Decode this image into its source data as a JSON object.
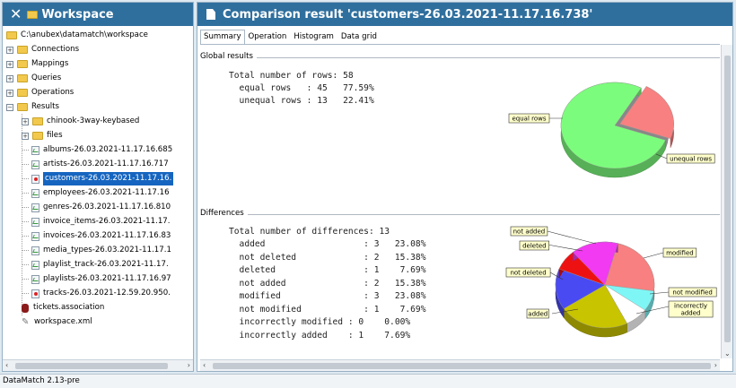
{
  "workspace": {
    "title": "Workspace",
    "close_glyph": "✕",
    "root_path": "C:\\anubex\\datamatch\\workspace",
    "top_nodes": [
      "Connections",
      "Mappings",
      "Queries",
      "Operations",
      "Results"
    ],
    "result_folders": [
      "chinook-3way-keybased",
      "files"
    ],
    "result_files": [
      "albums-26.03.2021-11.17.16.685",
      "artists-26.03.2021-11.17.16.717",
      "customers-26.03.2021-11.17.16.",
      "employees-26.03.2021-11.17.16",
      "genres-26.03.2021-11.17.16.810",
      "invoice_items-26.03.2021-11.17.",
      "invoices-26.03.2021-11.17.16.83",
      "media_types-26.03.2021-11.17.1",
      "playlist_track-26.03.2021-11.17.",
      "playlists-26.03.2021-11.17.16.97",
      "tracks-26.03.2021-12.59.20.950."
    ],
    "other_files": [
      "tickets.association",
      "workspace.xml"
    ]
  },
  "result": {
    "title": "Comparison result 'customers-26.03.2021-11.17.16.738'",
    "tabs": [
      "Summary",
      "Operation",
      "Histogram",
      "Data grid"
    ],
    "active_tab": "Summary"
  },
  "global": {
    "section_title": "Global results",
    "lines": [
      "Total number of rows: 58",
      "  equal rows   : 45   77.59%",
      "  unequal rows : 13   22.41%"
    ]
  },
  "differences": {
    "section_title": "Differences",
    "lines": [
      "Total number of differences: 13",
      "  added                   : 3   23.08%",
      "  not deleted             : 2   15.38%",
      "  deleted                 : 1    7.69%",
      "  not added               : 2   15.38%",
      "  modified                : 3   23.08%",
      "  not modified            : 1    7.69%",
      "  incorrectly modified : 0    0.00%",
      "  incorrectly added    : 1    7.69%"
    ]
  },
  "chart_data": [
    {
      "type": "pie",
      "title": "",
      "labels": [
        "equal rows",
        "unequal rows"
      ],
      "values": [
        45,
        13
      ],
      "colors": [
        "#7cfc7c",
        "#f88080"
      ]
    },
    {
      "type": "pie",
      "title": "",
      "labels": [
        "modified",
        "not modified",
        "incorrectly added",
        "added",
        "not added",
        "deleted",
        "not added"
      ],
      "display_labels": [
        "modified",
        "not modified",
        "incorrectly\nadded",
        "added",
        "not deleted",
        "deleted",
        "not added"
      ],
      "values": [
        3,
        1,
        1,
        3,
        2,
        1,
        2
      ],
      "colors": [
        "#f88080",
        "#7ff6f6",
        "#ffffff",
        "#c9c400",
        "#4a4af2",
        "#ee1111",
        "#f13af1"
      ]
    }
  ],
  "status": {
    "text": "DataMatch 2.13-pre"
  },
  "colors": {
    "header": "#2f6f9e",
    "selection": "#1565c0",
    "folder": "#f2c94c"
  }
}
